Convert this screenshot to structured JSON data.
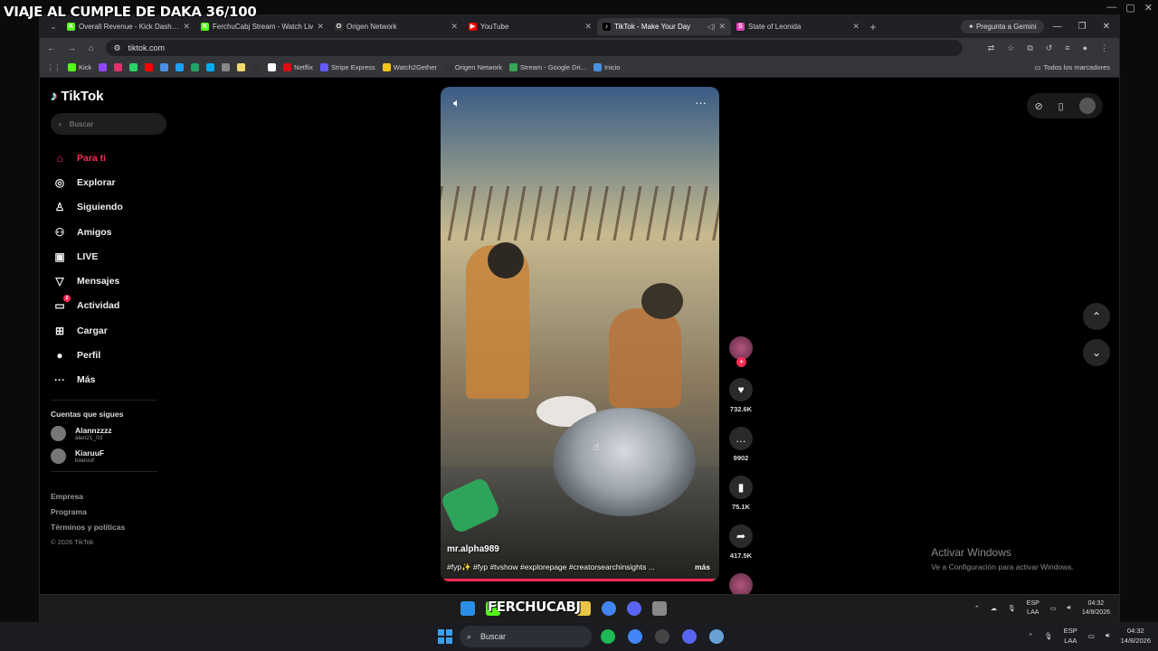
{
  "overlay_title": "VIAJE AL CUMPLE DE DAKA 36/100",
  "browser": {
    "tabs": [
      {
        "title": "Overall Revenue - Kick Dashbo",
        "color": "#53fc18",
        "glyph": "K"
      },
      {
        "title": "FerchuCabj Stream - Watch Liv",
        "color": "#53fc18",
        "glyph": "K"
      },
      {
        "title": "Origen Network",
        "color": "#333333",
        "glyph": "O"
      },
      {
        "title": "YouTube",
        "color": "#ff0000",
        "glyph": "▶"
      },
      {
        "title": "TikTok - Make Your Day",
        "color": "#000000",
        "glyph": "♪",
        "active": true
      },
      {
        "title": "State of Leonida",
        "color": "#e23fb3",
        "glyph": "S"
      }
    ],
    "gemini_label": "Pregunta a Gemini",
    "url": "tiktok.com",
    "bookmarks": [
      {
        "label": "Kick",
        "color": "#53fc18"
      },
      {
        "label": "",
        "color": "#9146ff"
      },
      {
        "label": "",
        "color": "#e1306c"
      },
      {
        "label": "",
        "color": "#25d366"
      },
      {
        "label": "",
        "color": "#ff0000"
      },
      {
        "label": "",
        "color": "#4a90e2"
      },
      {
        "label": "",
        "color": "#1da1f2"
      },
      {
        "label": "",
        "color": "#21a366"
      },
      {
        "label": "",
        "color": "#00aced"
      },
      {
        "label": "",
        "color": "#888888"
      },
      {
        "label": "",
        "color": "#f5d76e"
      },
      {
        "label": "",
        "color": "#333333"
      },
      {
        "label": "",
        "color": "#ffffff"
      },
      {
        "label": "Netflix",
        "color": "#e50914"
      },
      {
        "label": "Stripe Express",
        "color": "#635bff"
      },
      {
        "label": "Watch2Gether",
        "color": "#f5c518"
      },
      {
        "label": "Origen Network",
        "color": "#333333"
      },
      {
        "label": "Stream - Google Dri...",
        "color": "#34a853"
      },
      {
        "label": "Inicio",
        "color": "#4a90e2"
      }
    ],
    "bookmarks_folder": "Todos los marcadores"
  },
  "tiktok": {
    "logo_text": "TikTok",
    "search_placeholder": "Buscar",
    "nav": [
      {
        "label": "Para ti",
        "icon": "home-icon",
        "glyph": "⌂",
        "active": true
      },
      {
        "label": "Explorar",
        "icon": "compass-icon",
        "glyph": "◎"
      },
      {
        "label": "Siguiendo",
        "icon": "following-icon",
        "glyph": "♙"
      },
      {
        "label": "Amigos",
        "icon": "friends-icon",
        "glyph": "⚇"
      },
      {
        "label": "LIVE",
        "icon": "live-icon",
        "glyph": "▣"
      },
      {
        "label": "Mensajes",
        "icon": "messages-icon",
        "glyph": "▽"
      },
      {
        "label": "Actividad",
        "icon": "activity-icon",
        "glyph": "▭",
        "badge": "2"
      },
      {
        "label": "Cargar",
        "icon": "upload-icon",
        "glyph": "⊞"
      },
      {
        "label": "Perfil",
        "icon": "profile-icon",
        "glyph": "●"
      },
      {
        "label": "Más",
        "icon": "more-icon",
        "glyph": "···"
      }
    ],
    "following_title": "Cuentas que sigues",
    "following": [
      {
        "name": "Alannzzzz",
        "username": "alan21_03"
      },
      {
        "name": "KiaruuF",
        "username": "kiiaruuf"
      }
    ],
    "footer": [
      "Empresa",
      "Programa",
      "Términos y políticas"
    ],
    "copyright": "© 2026 TikTok",
    "video": {
      "author": "mr.alpha989",
      "caption": "#fyp✨ #fyp #tvshow #explorepage #creatorsearchinsights ...",
      "more_label": "más",
      "progress": 0.98
    },
    "actions": {
      "likes": "732.6K",
      "comments": "9902",
      "saves": "75.1K",
      "shares": "417.5K"
    }
  },
  "windows_watermark": {
    "title": "Activar Windows",
    "subtitle": "Ve a Configuración para activar Windows."
  },
  "stream_overlay_name": "FERCHUCABJ",
  "inner_taskbar": {
    "lang1": "ESP",
    "lang2": "LAA",
    "time": "04:32",
    "date": "14/8/2026"
  },
  "os_taskbar": {
    "search_placeholder": "Buscar",
    "lang1": "ESP",
    "lang2": "LAA",
    "time": "04:32",
    "date": "14/8/2026"
  }
}
